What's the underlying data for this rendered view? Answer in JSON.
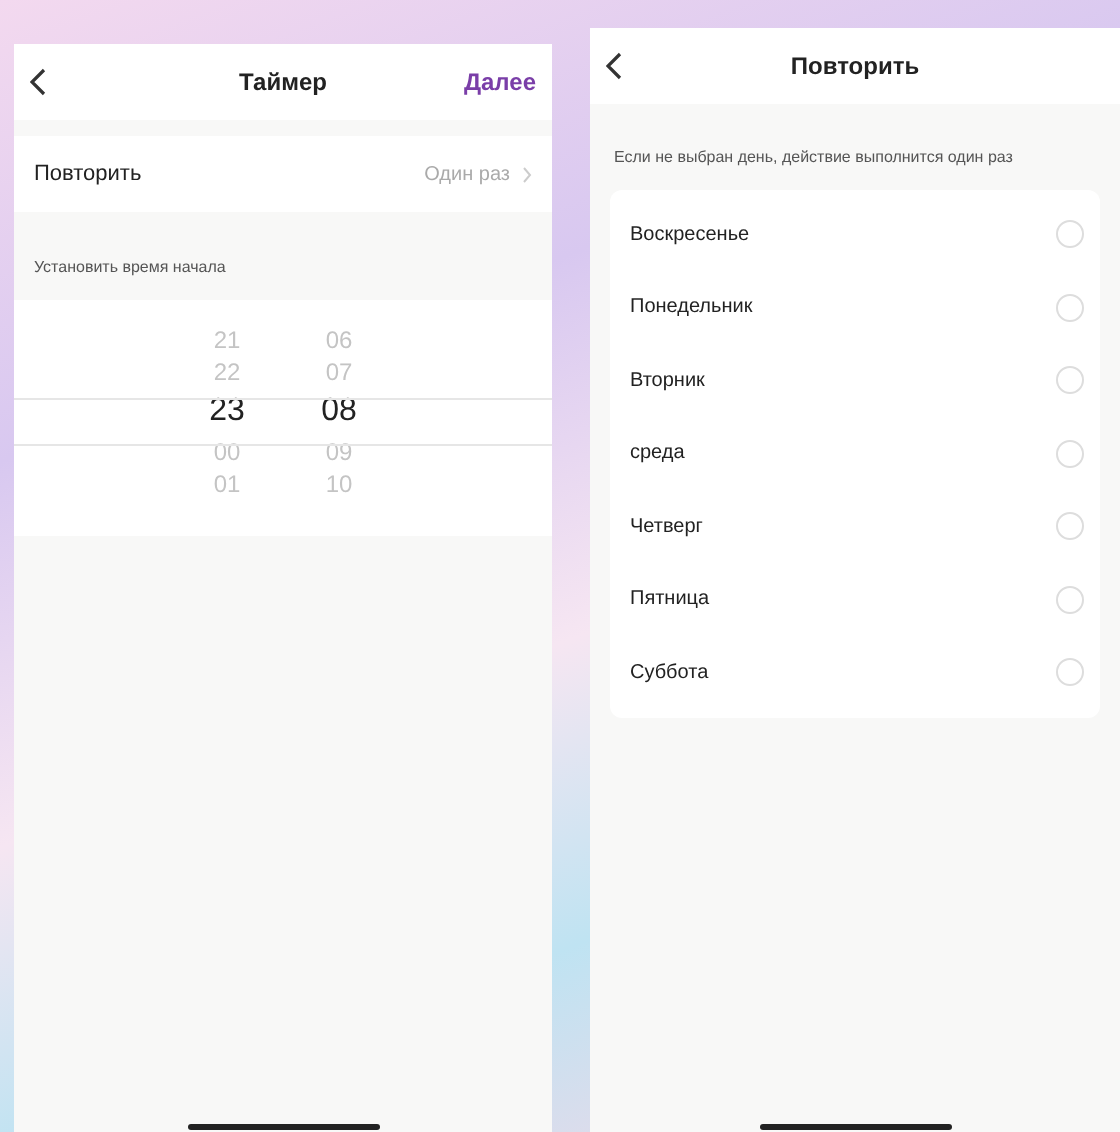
{
  "timer_screen": {
    "title": "Таймер",
    "next_button": "Далее",
    "repeat_row": {
      "label": "Повторить",
      "value": "Один раз"
    },
    "section_label": "Установить время начала",
    "picker": [
      {
        "items": [
          {
            "text": "21",
            "selected": false
          },
          {
            "text": "22",
            "selected": false
          },
          {
            "text": "23",
            "selected": true
          },
          {
            "text": "00",
            "selected": false
          },
          {
            "text": "01",
            "selected": false
          }
        ]
      },
      {
        "items": [
          {
            "text": "06",
            "selected": false
          },
          {
            "text": "07",
            "selected": false
          },
          {
            "text": "08",
            "selected": true
          },
          {
            "text": "09",
            "selected": false
          },
          {
            "text": "10",
            "selected": false
          }
        ]
      }
    ]
  },
  "repeat_screen": {
    "title": "Повторить",
    "hint": "Если не выбран день, действие выполнится один раз",
    "days": [
      {
        "label": "Воскресенье",
        "checked": false
      },
      {
        "label": "Понедельник",
        "checked": false
      },
      {
        "label": "Вторник",
        "checked": false
      },
      {
        "label": "среда",
        "checked": false
      },
      {
        "label": "Четверг",
        "checked": false
      },
      {
        "label": "Пятница",
        "checked": false
      },
      {
        "label": "Суббота",
        "checked": false
      }
    ]
  }
}
